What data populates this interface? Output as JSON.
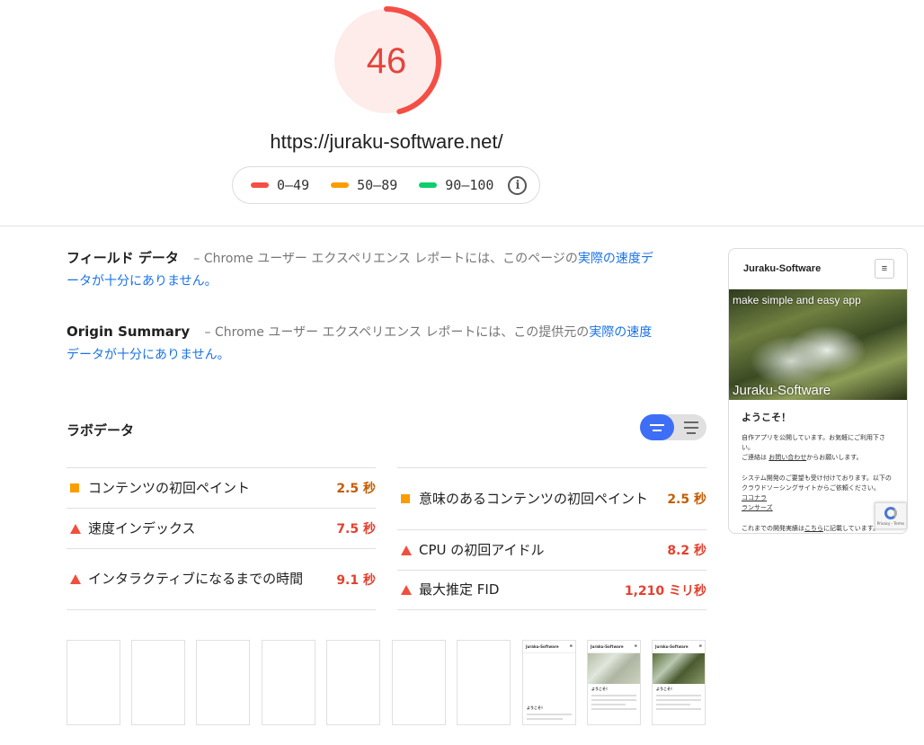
{
  "score": {
    "value": "46",
    "fraction": 0.46,
    "color": "#e5443c"
  },
  "url": "https://juraku-software.net/",
  "legend": [
    {
      "label": "0–49",
      "color": "#f44f45"
    },
    {
      "label": "50–89",
      "color": "#fa9d00"
    },
    {
      "label": "90–100",
      "color": "#0cce6b"
    }
  ],
  "field": {
    "title": "フィールド データ",
    "text": " – Chrome ユーザー エクスペリエンス レポートには、このページの",
    "link": "実際の速度データが十分にありません。"
  },
  "origin": {
    "title": "Origin Summary",
    "text": " – Chrome ユーザー エクスペリエンス レポートには、この提供元の",
    "link": "実際の速度データが十分にありません。"
  },
  "lab": {
    "title": "ラボデータ"
  },
  "metrics_left": [
    {
      "label": "コンテンツの初回ペイント",
      "value": "2.5 秒",
      "rating": "average"
    },
    {
      "label": "速度インデックス",
      "value": "7.5 秒",
      "rating": "fail"
    },
    {
      "label": "インタラクティブになるまでの時間",
      "value": "9.1 秒",
      "rating": "fail"
    }
  ],
  "metrics_right": [
    {
      "label": "意味のあるコンテンツの初回ペイント",
      "value": "2.5 秒",
      "rating": "average"
    },
    {
      "label": "CPU の初回アイドル",
      "value": "8.2 秒",
      "rating": "fail"
    },
    {
      "label": "最大推定 FID",
      "value": "1,210 ミリ秒",
      "rating": "fail"
    }
  ],
  "preview": {
    "site_name": "Juraku-Software",
    "tagline": "make simple and easy app",
    "brand": "Juraku-Software",
    "welcome": "ようこそ！",
    "p1a": "自作アプリを公開しています。お気軽にご利用下さい。",
    "p1b_prefix": "ご連絡は ",
    "p1b_link": "お問い合わせ",
    "p1b_suffix": "からお願いします。",
    "p2": "システム開発のご要望も受け付けております。以下のクラウドソーシングサイトからご依頼ください。",
    "link1": "ココナラ",
    "link2": "ランサーズ",
    "p3_prefix": "これまでの開発実績は",
    "p3_link": "こちら",
    "p3_suffix": "に記載しています。",
    "recaptcha_text": "Privacy - Terms"
  },
  "filmstrip": {
    "mini_title": "Juraku-Software",
    "mini_welcome": "ようこそ！",
    "menu_glyph": "≡"
  }
}
